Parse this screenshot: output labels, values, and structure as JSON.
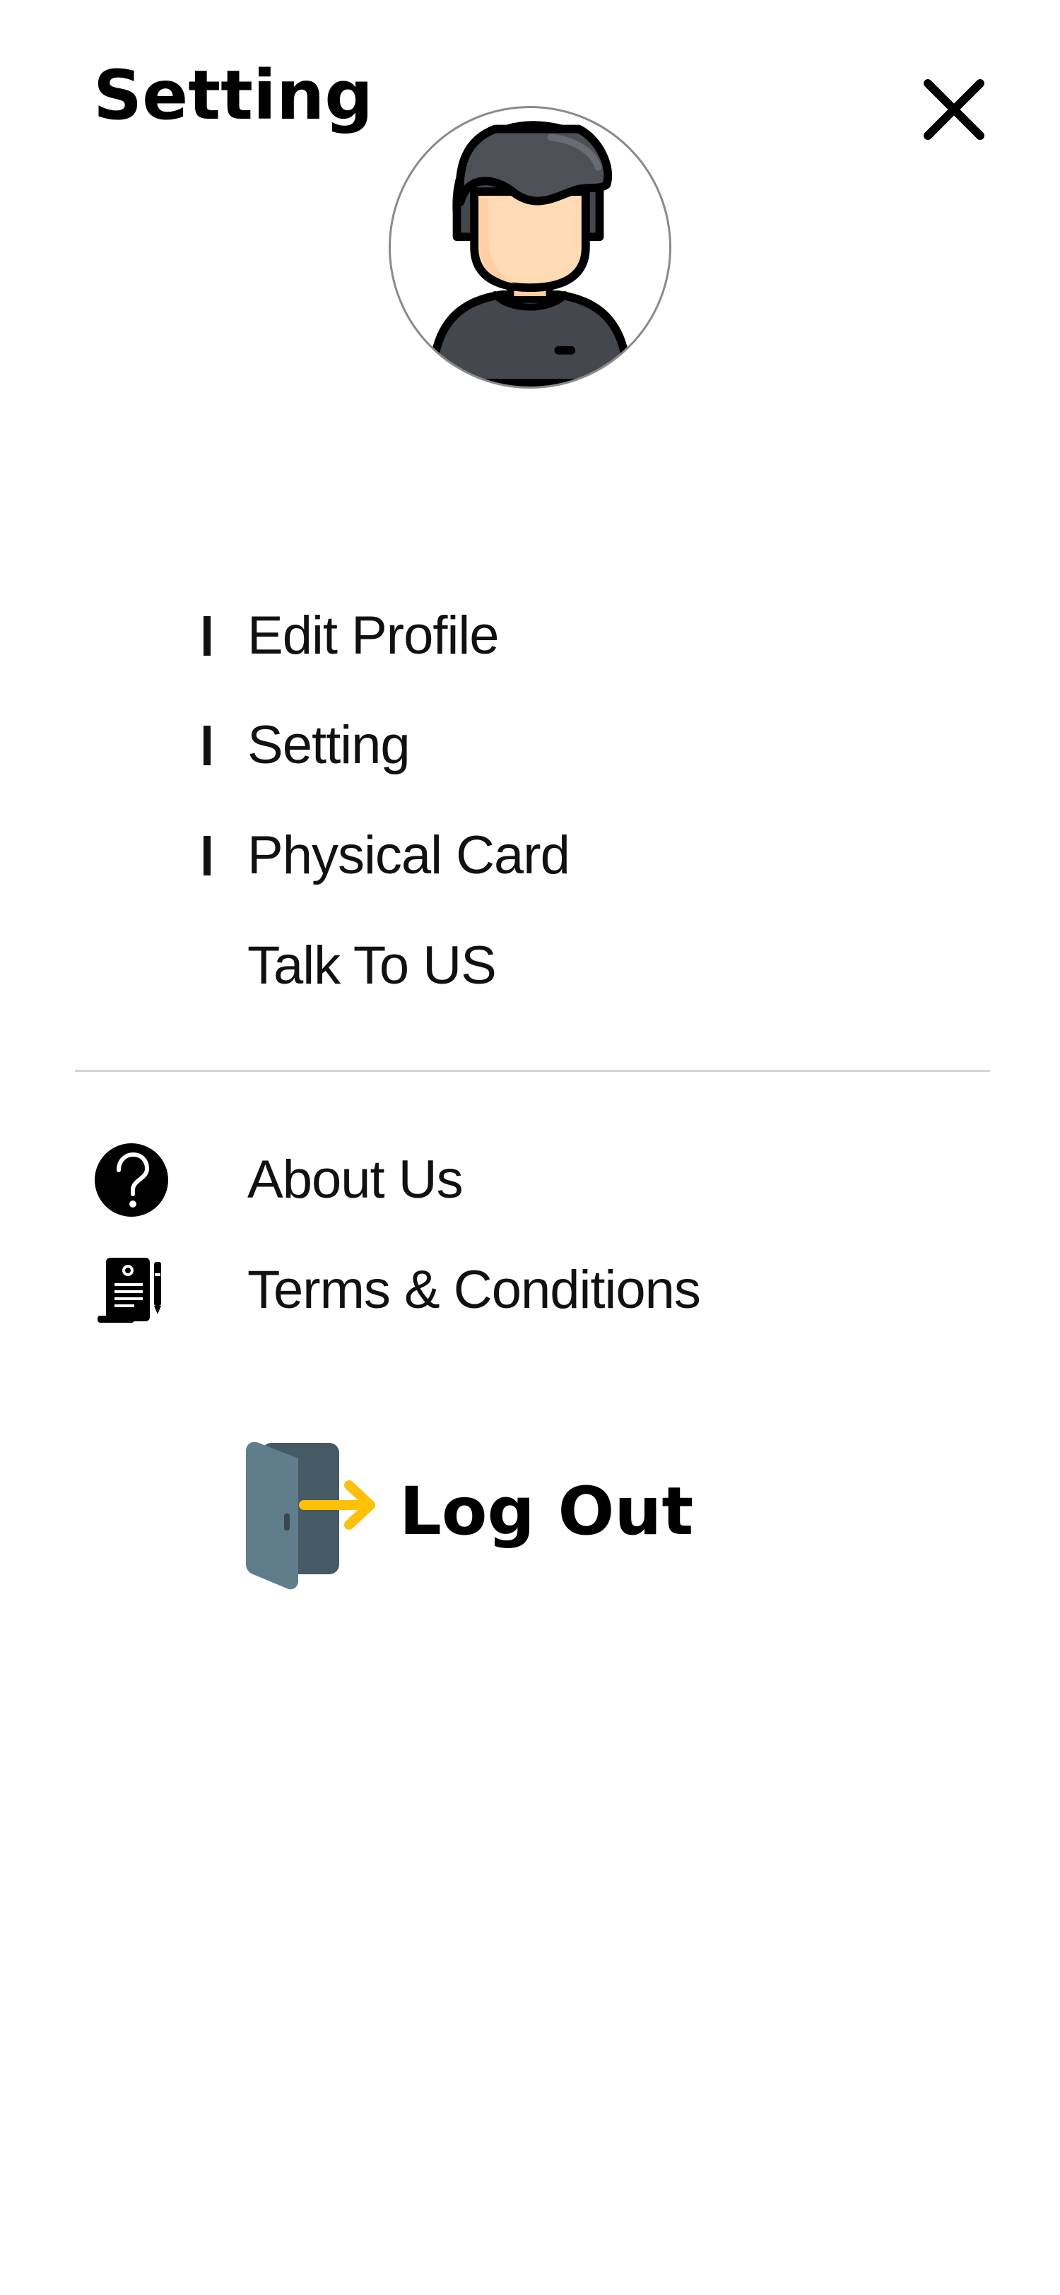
{
  "header": {
    "title": "Setting",
    "close_icon": "close-icon"
  },
  "profile": {
    "avatar_icon": "user-avatar-icon"
  },
  "menu": {
    "items": [
      {
        "label": "Edit Profile",
        "has_bar": true
      },
      {
        "label": "Setting",
        "has_bar": true
      },
      {
        "label": "Physical Card",
        "has_bar": true
      },
      {
        "label": "Talk To US",
        "has_bar": false
      }
    ]
  },
  "info": {
    "items": [
      {
        "label": "About Us",
        "icon": "question-circle-icon"
      },
      {
        "label": "Terms & Conditions",
        "icon": "document-pen-icon"
      }
    ]
  },
  "logout": {
    "label": "Log Out",
    "icon": "door-exit-icon",
    "colors": {
      "door_front": "#607d8b",
      "door_back": "#455a64",
      "arrow": "#ffc107"
    }
  }
}
